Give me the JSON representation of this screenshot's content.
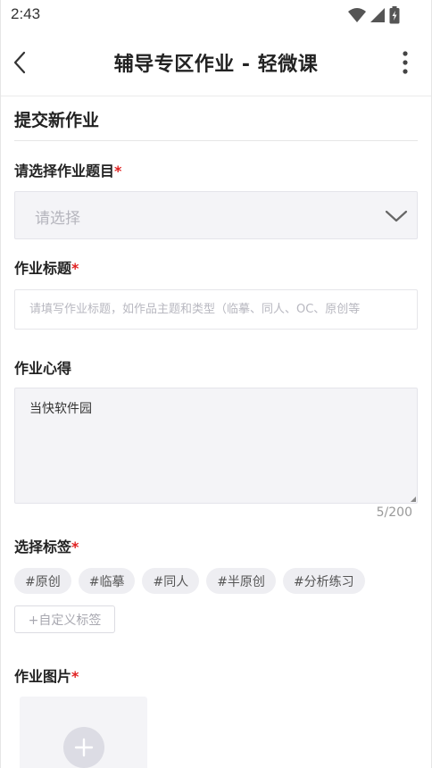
{
  "status_bar": {
    "time": "2:43",
    "icons": [
      "wifi-icon",
      "signal-icon",
      "battery-charging-icon"
    ]
  },
  "nav": {
    "back_icon": "chevron-left-icon",
    "title": "辅导专区作业 - 轻微课",
    "more_icon": "more-vertical-icon"
  },
  "section": {
    "title": "提交新作业"
  },
  "form": {
    "topic": {
      "label": "请选择作业题目",
      "required_mark": "*",
      "placeholder": "请选择",
      "chevron_icon": "chevron-down-icon"
    },
    "title": {
      "label": "作业标题",
      "required_mark": "*",
      "placeholder": "请填写作业标题，如作品主题和类型（临摹、同人、OC、原创等",
      "value": ""
    },
    "notes": {
      "label": "作业心得",
      "value": "当快软件园",
      "counter": "5/200"
    },
    "tags": {
      "label": "选择标签",
      "required_mark": "*",
      "items": [
        "#原创",
        "#临摹",
        "#同人",
        "#半原创",
        "#分析练习"
      ],
      "custom_label": "+自定义标签"
    },
    "images": {
      "label": "作业图片",
      "required_mark": "*",
      "add_icon": "plus-icon"
    }
  },
  "colors": {
    "required": "#e02020",
    "input_bg": "#f4f4f7",
    "tag_bg": "#eeeef2"
  }
}
